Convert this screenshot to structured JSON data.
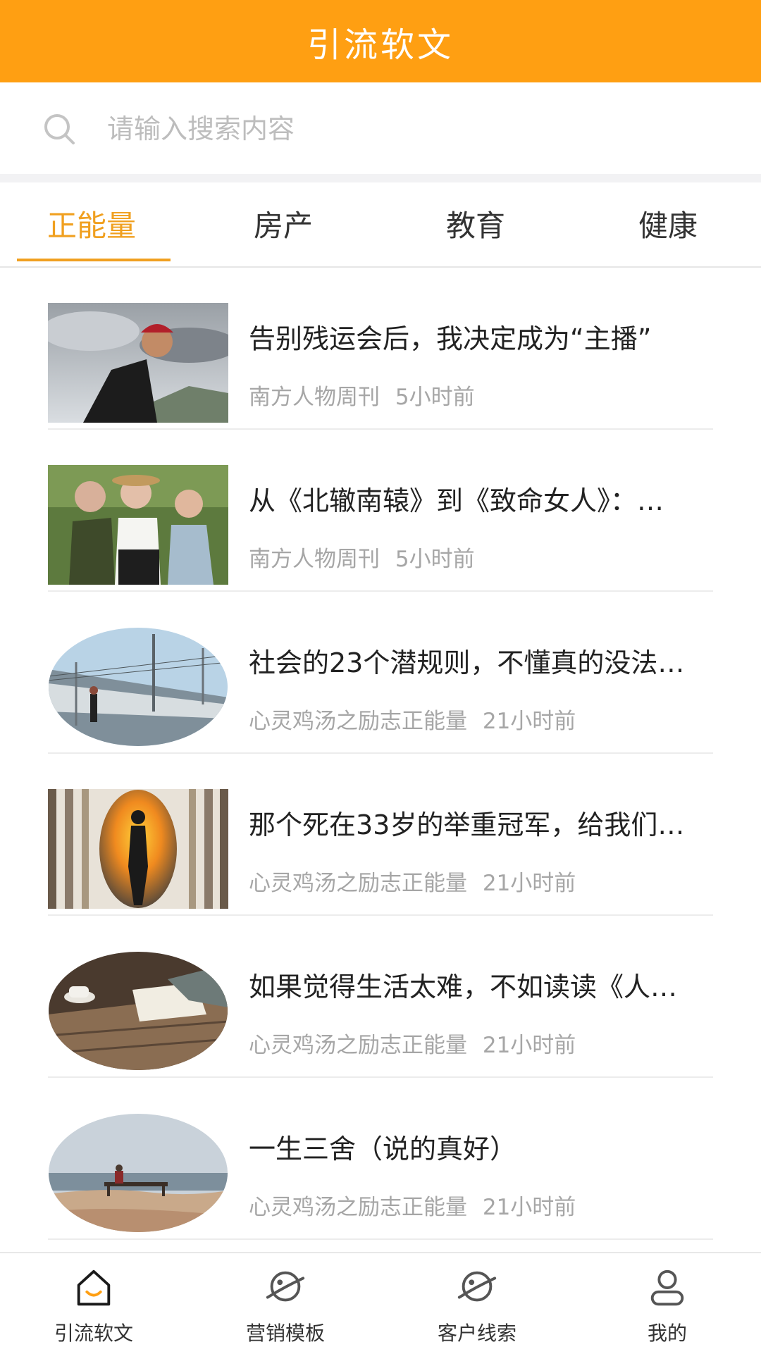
{
  "header": {
    "title": "引流软文"
  },
  "search": {
    "placeholder": "请输入搜索内容",
    "icon": "search-icon"
  },
  "tabs": [
    {
      "label": "正能量",
      "active": true
    },
    {
      "label": "房产",
      "active": false
    },
    {
      "label": "教育",
      "active": false
    },
    {
      "label": "健康",
      "active": false
    }
  ],
  "articles": [
    {
      "title": "告别残运会后，我决定成为“主播”",
      "source": "南方人物周刊",
      "time": "5小时前"
    },
    {
      "title": "从《北辙南辕》到《致命女人》：…",
      "source": "南方人物周刊",
      "time": "5小时前"
    },
    {
      "title": "社会的23个潜规则，不懂真的没法…",
      "source": "心灵鸡汤之励志正能量",
      "time": "21小时前"
    },
    {
      "title": "那个死在33岁的举重冠军，给我们…",
      "source": "心灵鸡汤之励志正能量",
      "time": "21小时前"
    },
    {
      "title": "如果觉得生活太难，不如读读《人…",
      "source": "心灵鸡汤之励志正能量",
      "time": "21小时前"
    },
    {
      "title": "一生三舍（说的真好）",
      "source": "心灵鸡汤之励志正能量",
      "time": "21小时前"
    }
  ],
  "bottom_nav": [
    {
      "label": "引流软文",
      "icon": "home-icon",
      "active": true
    },
    {
      "label": "营销模板",
      "icon": "planet-icon",
      "active": false
    },
    {
      "label": "客户线索",
      "icon": "planet-icon",
      "active": false
    },
    {
      "label": "我的",
      "icon": "profile-icon",
      "active": false
    }
  ],
  "colors": {
    "accent": "#ff9f12",
    "tab_active": "#f0a020"
  }
}
